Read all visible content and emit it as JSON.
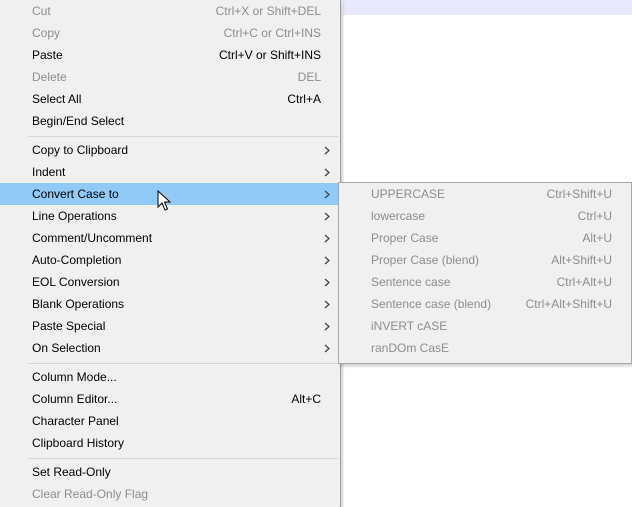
{
  "menu": {
    "items": [
      {
        "label": "Cut",
        "shortcut": "Ctrl+X or Shift+DEL"
      },
      {
        "label": "Copy",
        "shortcut": "Ctrl+C or Ctrl+INS"
      },
      {
        "label": "Paste",
        "shortcut": "Ctrl+V or Shift+INS"
      },
      {
        "label": "Delete",
        "shortcut": "DEL"
      },
      {
        "label": "Select All",
        "shortcut": "Ctrl+A"
      },
      {
        "label": "Begin/End Select",
        "shortcut": ""
      },
      {
        "label": "Copy to Clipboard",
        "shortcut": ""
      },
      {
        "label": "Indent",
        "shortcut": ""
      },
      {
        "label": "Convert Case to",
        "shortcut": ""
      },
      {
        "label": "Line Operations",
        "shortcut": ""
      },
      {
        "label": "Comment/Uncomment",
        "shortcut": ""
      },
      {
        "label": "Auto-Completion",
        "shortcut": ""
      },
      {
        "label": "EOL Conversion",
        "shortcut": ""
      },
      {
        "label": "Blank Operations",
        "shortcut": ""
      },
      {
        "label": "Paste Special",
        "shortcut": ""
      },
      {
        "label": "On Selection",
        "shortcut": ""
      },
      {
        "label": "Column Mode...",
        "shortcut": ""
      },
      {
        "label": "Column Editor...",
        "shortcut": "Alt+C"
      },
      {
        "label": "Character Panel",
        "shortcut": ""
      },
      {
        "label": "Clipboard History",
        "shortcut": ""
      },
      {
        "label": "Set Read-Only",
        "shortcut": ""
      },
      {
        "label": "Clear Read-Only Flag",
        "shortcut": ""
      }
    ]
  },
  "submenu": {
    "items": [
      {
        "label": "UPPERCASE",
        "shortcut": "Ctrl+Shift+U"
      },
      {
        "label": "lowercase",
        "shortcut": "Ctrl+U"
      },
      {
        "label": "Proper Case",
        "shortcut": "Alt+U"
      },
      {
        "label": "Proper Case (blend)",
        "shortcut": "Alt+Shift+U"
      },
      {
        "label": "Sentence case",
        "shortcut": "Ctrl+Alt+U"
      },
      {
        "label": "Sentence case (blend)",
        "shortcut": "Ctrl+Alt+Shift+U"
      },
      {
        "label": "iNVERT cASE",
        "shortcut": ""
      },
      {
        "label": "ranDOm CasE",
        "shortcut": ""
      }
    ]
  },
  "colors": {
    "menu_bg": "#f0f0f0",
    "highlight": "#91c9f7",
    "disabled_text": "#8d8d8d",
    "separator": "#d7d7d7"
  },
  "icons": {
    "submenu_arrow": "chevron-right-icon",
    "cursor": "mouse-pointer-icon"
  }
}
